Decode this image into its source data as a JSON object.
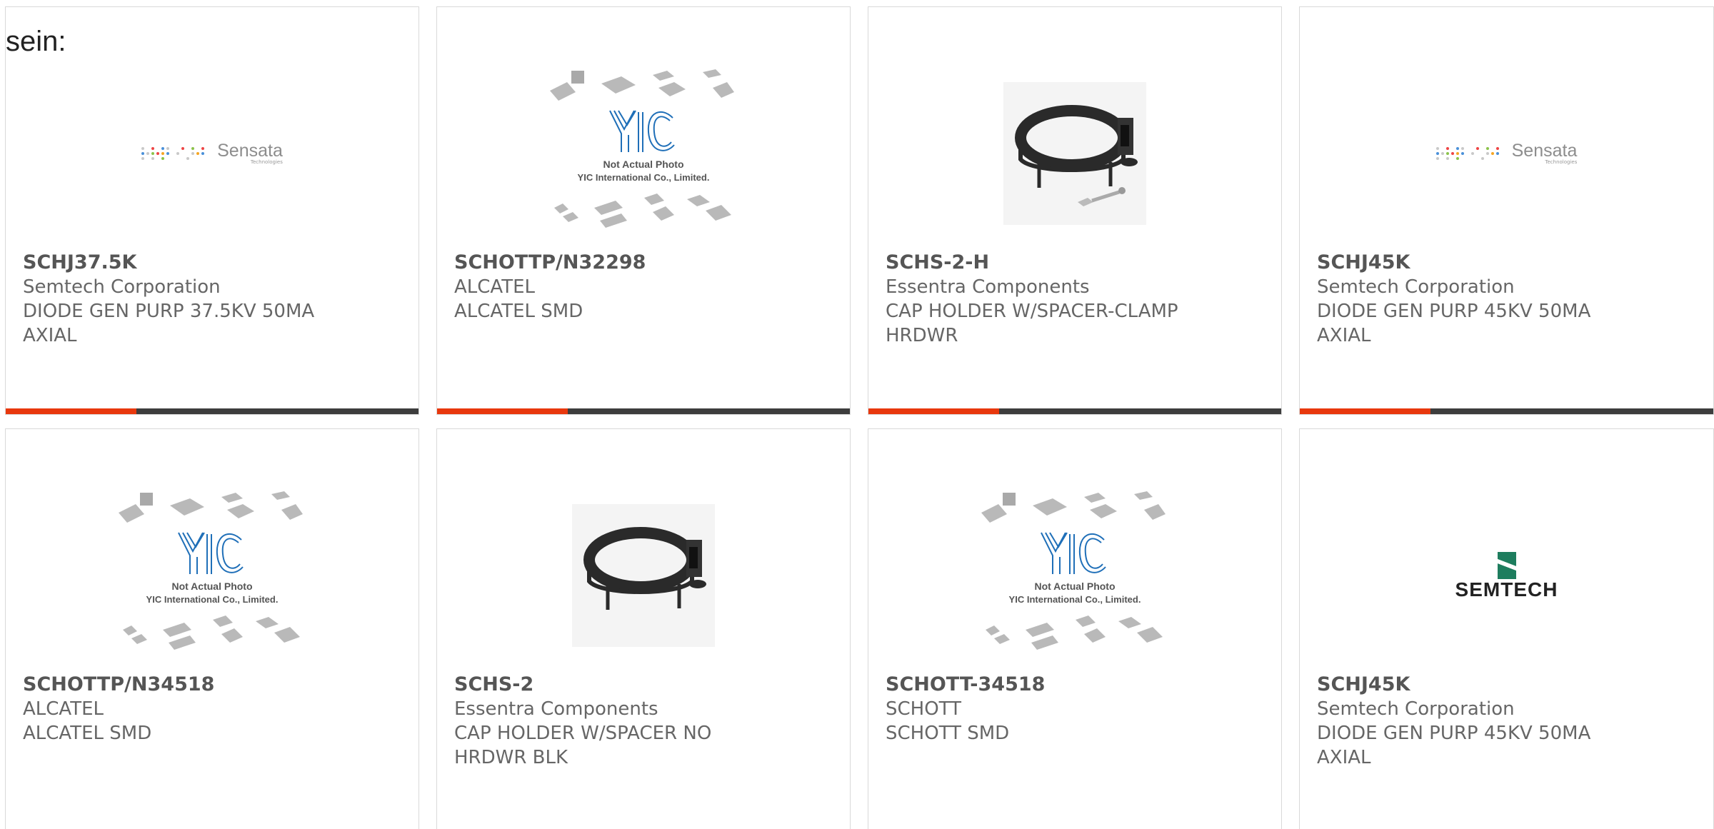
{
  "heading": "sein:",
  "cards": [
    {
      "part_no": "SCHJ37.5K",
      "manufacturer": "Semtech Corporation",
      "desc_line1": "DIODE GEN PURP 37.5KV 50MA",
      "desc_line2": "AXIAL",
      "image": "sensata-logo",
      "logo_text": "Sensata",
      "logo_sub": "Technologies"
    },
    {
      "part_no": "SCHOTTP/N32298",
      "manufacturer": "ALCATEL",
      "desc_line1": "ALCATEL SMD",
      "desc_line2": "",
      "image": "yic-placeholder",
      "photo_note1": "Not Actual Photo",
      "photo_note2": "YIC International Co., Limited."
    },
    {
      "part_no": "SCHS-2-H",
      "manufacturer": "Essentra Components",
      "desc_line1": "CAP HOLDER W/SPACER-CLAMP",
      "desc_line2": "HRDWR",
      "image": "clamp-with-hardware"
    },
    {
      "part_no": "SCHJ45K",
      "manufacturer": "Semtech Corporation",
      "desc_line1": "DIODE GEN PURP 45KV 50MA",
      "desc_line2": "AXIAL",
      "image": "sensata-logo",
      "logo_text": "Sensata",
      "logo_sub": "Technologies"
    },
    {
      "part_no": "SCHOTTP/N34518",
      "manufacturer": "ALCATEL",
      "desc_line1": "ALCATEL SMD",
      "desc_line2": "",
      "image": "yic-placeholder",
      "photo_note1": "Not Actual Photo",
      "photo_note2": "YIC International Co., Limited."
    },
    {
      "part_no": "SCHS-2",
      "manufacturer": "Essentra Components",
      "desc_line1": "CAP HOLDER W/SPACER NO",
      "desc_line2": "HRDWR BLK",
      "image": "clamp"
    },
    {
      "part_no": "SCHOTT-34518",
      "manufacturer": "SCHOTT",
      "desc_line1": "SCHOTT SMD",
      "desc_line2": "",
      "image": "yic-placeholder",
      "photo_note1": "Not Actual Photo",
      "photo_note2": "YIC International Co., Limited."
    },
    {
      "part_no": "SCHJ45K",
      "manufacturer": "Semtech Corporation",
      "desc_line1": "DIODE GEN PURP 45KV 50MA",
      "desc_line2": "AXIAL",
      "image": "semtech-logo",
      "logo_text": "SEMTECH"
    }
  ],
  "colors": {
    "accent": "#e8380d",
    "bar": "#3d3d3d",
    "border": "#d9d9d9",
    "yic_blue": "#1f6fb8"
  }
}
